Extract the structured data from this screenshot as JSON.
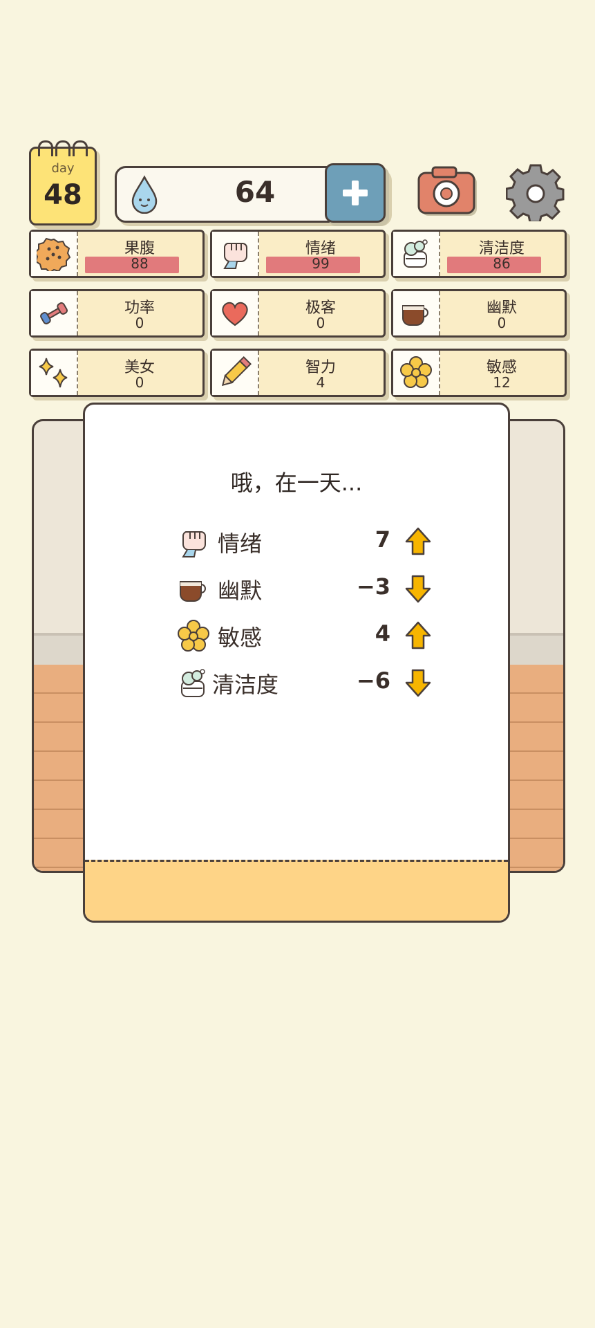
{
  "calendar": {
    "label": "day",
    "day": "48"
  },
  "water": {
    "amount": "64",
    "icon": "water-drop-icon"
  },
  "header": {
    "add_icon": "plus-icon",
    "camera_icon": "camera-icon",
    "settings_icon": "gear-icon"
  },
  "stats": [
    {
      "label": "果腹",
      "value": "88",
      "bar": true,
      "icon": "cookie-icon"
    },
    {
      "label": "情绪",
      "value": "99",
      "bar": true,
      "icon": "fist-icon"
    },
    {
      "label": "清洁度",
      "value": "86",
      "bar": true,
      "icon": "soap-icon"
    },
    {
      "label": "功率",
      "value": "0",
      "bar": false,
      "icon": "dumbbell-icon"
    },
    {
      "label": "极客",
      "value": "0",
      "bar": false,
      "icon": "heart-icon"
    },
    {
      "label": "幽默",
      "value": "0",
      "bar": false,
      "icon": "coffee-cup-icon"
    },
    {
      "label": "美女",
      "value": "0",
      "bar": false,
      "icon": "sparkle-icon"
    },
    {
      "label": "智力",
      "value": "4",
      "bar": false,
      "icon": "pencil-icon"
    },
    {
      "label": "敏感",
      "value": "12",
      "bar": false,
      "icon": "flower-icon"
    }
  ],
  "modal": {
    "title": "哦，在一天...",
    "changes": [
      {
        "name": "情绪",
        "delta": "7",
        "direction": "up",
        "icon": "fist-icon"
      },
      {
        "name": "幽默",
        "delta": "−3",
        "direction": "down",
        "icon": "coffee-cup-icon"
      },
      {
        "name": "敏感",
        "delta": "4",
        "direction": "up",
        "icon": "flower-icon"
      },
      {
        "name": "清洁度",
        "delta": "−6",
        "direction": "down",
        "icon": "soap-icon"
      }
    ]
  },
  "colors": {
    "background": "#f9f5df",
    "stat_bar": "#e17a7c",
    "arrow": "#f7b500",
    "plus_button": "#6e9fb8",
    "calendar": "#fde377",
    "modal_footer": "#fed487"
  }
}
